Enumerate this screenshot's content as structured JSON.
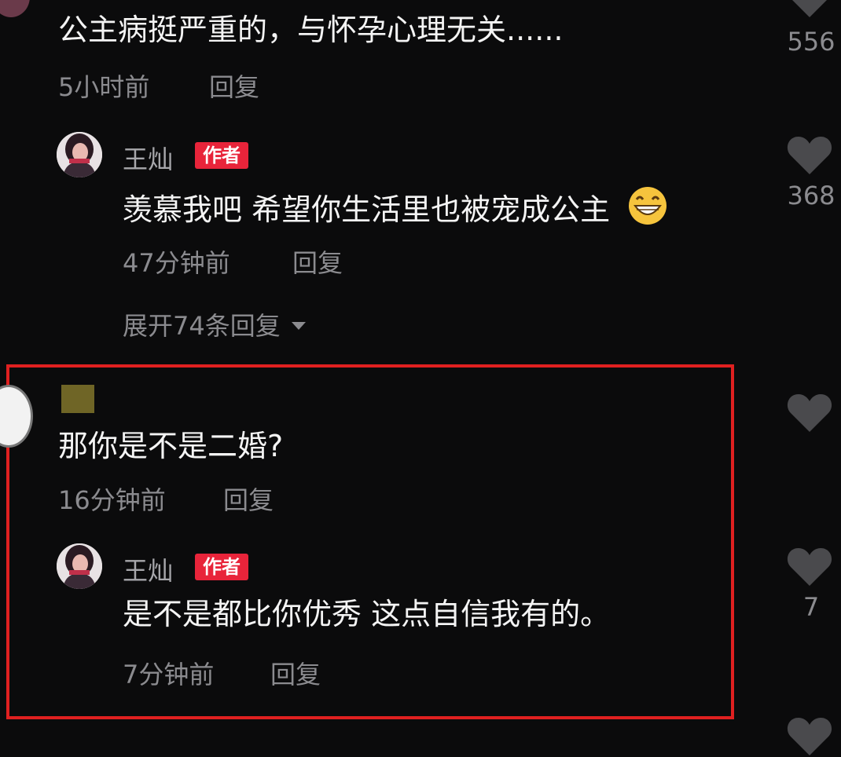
{
  "thread": [
    {
      "text": "公主病挺严重的，与怀孕心理无关......",
      "time": "5小时前",
      "reply": "回复",
      "likes": "556"
    },
    {
      "username": "王灿",
      "badge": "作者",
      "text": "羡慕我吧 希望你生活里也被宠成公主",
      "time": "47分钟前",
      "reply": "回复",
      "likes": "368"
    }
  ],
  "expand_replies": "展开74条回复",
  "highlighted": [
    {
      "text": "那你是不是二婚?",
      "time": "16分钟前",
      "reply": "回复"
    },
    {
      "username": "王灿",
      "badge": "作者",
      "text": "是不是都比你优秀 这点自信我有的。",
      "time": "7分钟前",
      "reply": "回复",
      "likes": "7"
    }
  ],
  "colors": {
    "background": "#0b0b0c",
    "badge": "#e8243a",
    "highlight_border": "#e02020",
    "muted": "#8b8b8f"
  },
  "icons": {
    "like": "heart-icon",
    "expand": "caret-down-icon",
    "emoji": "grinning-face-emoji"
  }
}
